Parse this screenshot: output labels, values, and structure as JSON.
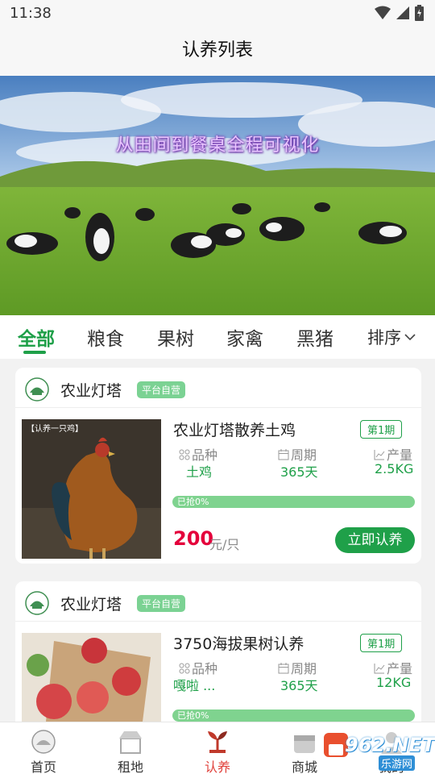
{
  "status": {
    "time": "11:38"
  },
  "header": {
    "title": "认养列表"
  },
  "banner": {
    "caption": "从田间到餐桌全程可视化"
  },
  "tabs": [
    {
      "label": "全部",
      "active": true
    },
    {
      "label": "粮食"
    },
    {
      "label": "果树"
    },
    {
      "label": "家禽"
    },
    {
      "label": "黑猪"
    }
  ],
  "sort": {
    "label": "排序"
  },
  "products": [
    {
      "shop_name": "农业灯塔",
      "shop_badge": "平台自营",
      "image_tag": "【认养一只鸡】",
      "title": "农业灯塔散养土鸡",
      "period": "第1期",
      "specs": [
        {
          "label": "品种",
          "value": "土鸡",
          "icon": "grid-icon"
        },
        {
          "label": "周期",
          "value": "365天",
          "icon": "calendar-icon"
        },
        {
          "label": "产量",
          "value": "2.5KG",
          "icon": "chart-icon"
        }
      ],
      "progress_label": "已抢0%",
      "progress": 0,
      "price": "200",
      "price_unit": "元/只",
      "button": "立即认养"
    },
    {
      "shop_name": "农业灯塔",
      "shop_badge": "平台自营",
      "title": "3750海拔果树认养",
      "period": "第1期",
      "specs": [
        {
          "label": "品种",
          "value": "嘎啦 ...",
          "icon": "grid-icon"
        },
        {
          "label": "周期",
          "value": "365天",
          "icon": "calendar-icon"
        },
        {
          "label": "产量",
          "value": "12KG",
          "icon": "chart-icon"
        }
      ],
      "progress_label": "已抢0%",
      "progress": 0
    }
  ],
  "bottom_nav": [
    {
      "label": "首页",
      "icon": "home-icon"
    },
    {
      "label": "租地",
      "icon": "land-icon"
    },
    {
      "label": "认养",
      "icon": "adopt-icon",
      "active": true
    },
    {
      "label": "商城",
      "icon": "shop-icon"
    },
    {
      "label": "我的",
      "icon": "user-icon"
    }
  ],
  "watermark": {
    "text": "962.NET",
    "sub": "乐游网"
  },
  "colors": {
    "accent": "#1fa049",
    "price": "#e4003b",
    "progress_track": "#7fd38f"
  }
}
